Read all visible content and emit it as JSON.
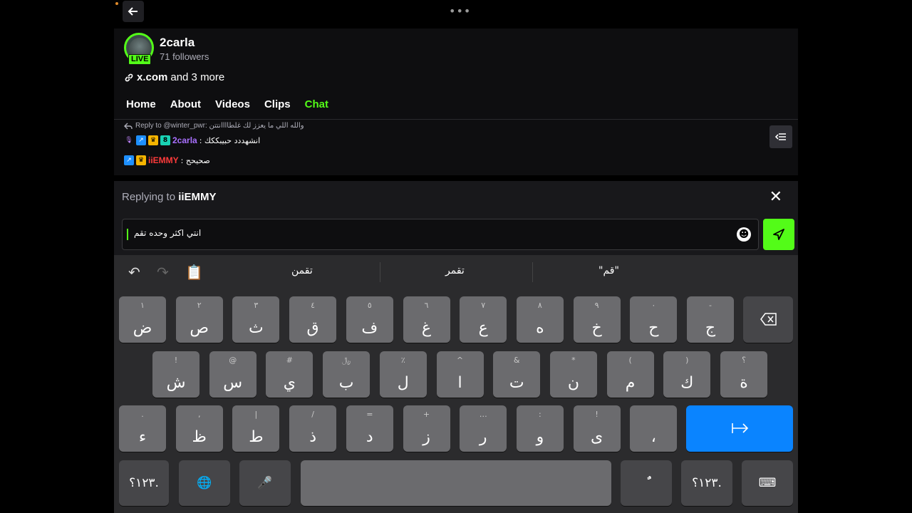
{
  "topbar": {
    "menu_dots": "•••"
  },
  "channel": {
    "name": "2carla",
    "followers": "71 followers",
    "live": "LIVE",
    "link_main": "x.com",
    "link_more": " and 3 more"
  },
  "tabs": [
    "Home",
    "About",
    "Videos",
    "Clips",
    "Chat"
  ],
  "chat": {
    "reply_context": "Reply to @winter_pwr: والله اللي ما يعزز لك غلطاااانتتن",
    "msg1_user": "2carla",
    "msg1_text": ": انشهددد حبيبككك",
    "msg1_sub_badge": "8",
    "msg2_user": "iiEMMY",
    "msg2_text": ": صحيحح"
  },
  "reply": {
    "prefix": "Replying to ",
    "user": "iiEMMY",
    "input_value": "انتي اكثر وحده تقم",
    "close": "✕"
  },
  "keyboard": {
    "suggestions": [
      "تقمن",
      "تقمر",
      "\"قم\""
    ],
    "row1": [
      [
        "١",
        "ض"
      ],
      [
        "٢",
        "ص"
      ],
      [
        "٣",
        "ث"
      ],
      [
        "٤",
        "ق"
      ],
      [
        "٥",
        "ف"
      ],
      [
        "٦",
        "غ"
      ],
      [
        "٧",
        "ع"
      ],
      [
        "٨",
        "ه"
      ],
      [
        "٩",
        "خ"
      ],
      [
        "٠",
        "ح"
      ],
      [
        "-",
        "ج"
      ]
    ],
    "row2": [
      [
        "!",
        "ش"
      ],
      [
        "@",
        "س"
      ],
      [
        "#",
        "ي"
      ],
      [
        "﷼",
        "ب"
      ],
      [
        "٪",
        "ل"
      ],
      [
        "^",
        "ا"
      ],
      [
        "&",
        "ت"
      ],
      [
        "*",
        "ن"
      ],
      [
        "(",
        "م"
      ],
      [
        ")",
        "ك"
      ],
      [
        "؟",
        "ة"
      ]
    ],
    "row3": [
      [
        ".",
        "ء"
      ],
      [
        ",",
        "ظ"
      ],
      [
        "|",
        "ط"
      ],
      [
        "/",
        "ذ"
      ],
      [
        "=",
        "د"
      ],
      [
        "+",
        "ز"
      ],
      [
        "…",
        "ر"
      ],
      [
        ":",
        "و"
      ],
      [
        "!",
        "ى"
      ],
      [
        "",
        "،"
      ]
    ],
    "numbers_label": "١٢٣؟.",
    "diacritic_label": "ًٌ"
  }
}
